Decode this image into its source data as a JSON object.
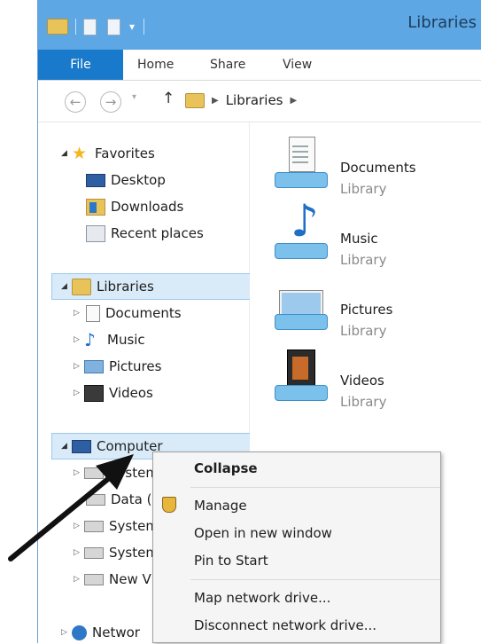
{
  "window": {
    "title": "Libraries"
  },
  "ribbon": {
    "tabs": [
      "File",
      "Home",
      "Share",
      "View"
    ]
  },
  "address": {
    "location": "Libraries"
  },
  "nav": {
    "favorites": {
      "label": "Favorites",
      "items": [
        "Desktop",
        "Downloads",
        "Recent places"
      ]
    },
    "libraries": {
      "label": "Libraries",
      "items": [
        "Documents",
        "Music",
        "Pictures",
        "Videos"
      ]
    },
    "computer": {
      "label": "Computer",
      "items": [
        "System",
        "Data (",
        "System",
        "System",
        "New V"
      ]
    },
    "network": {
      "label": "Networ"
    }
  },
  "content": {
    "libraries": [
      {
        "name": "Documents",
        "type": "Library",
        "icon": "documents-library-icon"
      },
      {
        "name": "Music",
        "type": "Library",
        "icon": "music-library-icon"
      },
      {
        "name": "Pictures",
        "type": "Library",
        "icon": "pictures-library-icon"
      },
      {
        "name": "Videos",
        "type": "Library",
        "icon": "videos-library-icon"
      }
    ]
  },
  "context_menu": {
    "items": [
      "Collapse",
      "Manage",
      "Open in new window",
      "Pin to Start",
      "Map network drive...",
      "Disconnect network drive..."
    ]
  },
  "colors": {
    "titlebar": "#5da7e4",
    "file_tab": "#1979ca",
    "selection": "#d9ebf9"
  }
}
